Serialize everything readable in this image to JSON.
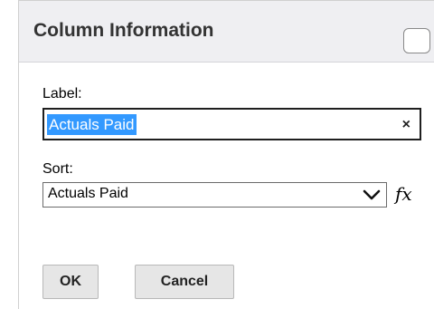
{
  "dialog": {
    "title": "Column Information",
    "label_field": {
      "label": "Label:",
      "value": "Actuals Paid",
      "clear_glyph": "×"
    },
    "sort_field": {
      "label": "Sort:",
      "selected": "Actuals Paid",
      "formula_glyph": "fx"
    },
    "buttons": {
      "ok": "OK",
      "cancel": "Cancel"
    }
  },
  "colors": {
    "selection": "#3399ff",
    "title_bar": "#efeff2"
  },
  "icons": {
    "clear": "close-icon",
    "dropdown": "chevron-down-icon",
    "formula": "fx-icon"
  }
}
